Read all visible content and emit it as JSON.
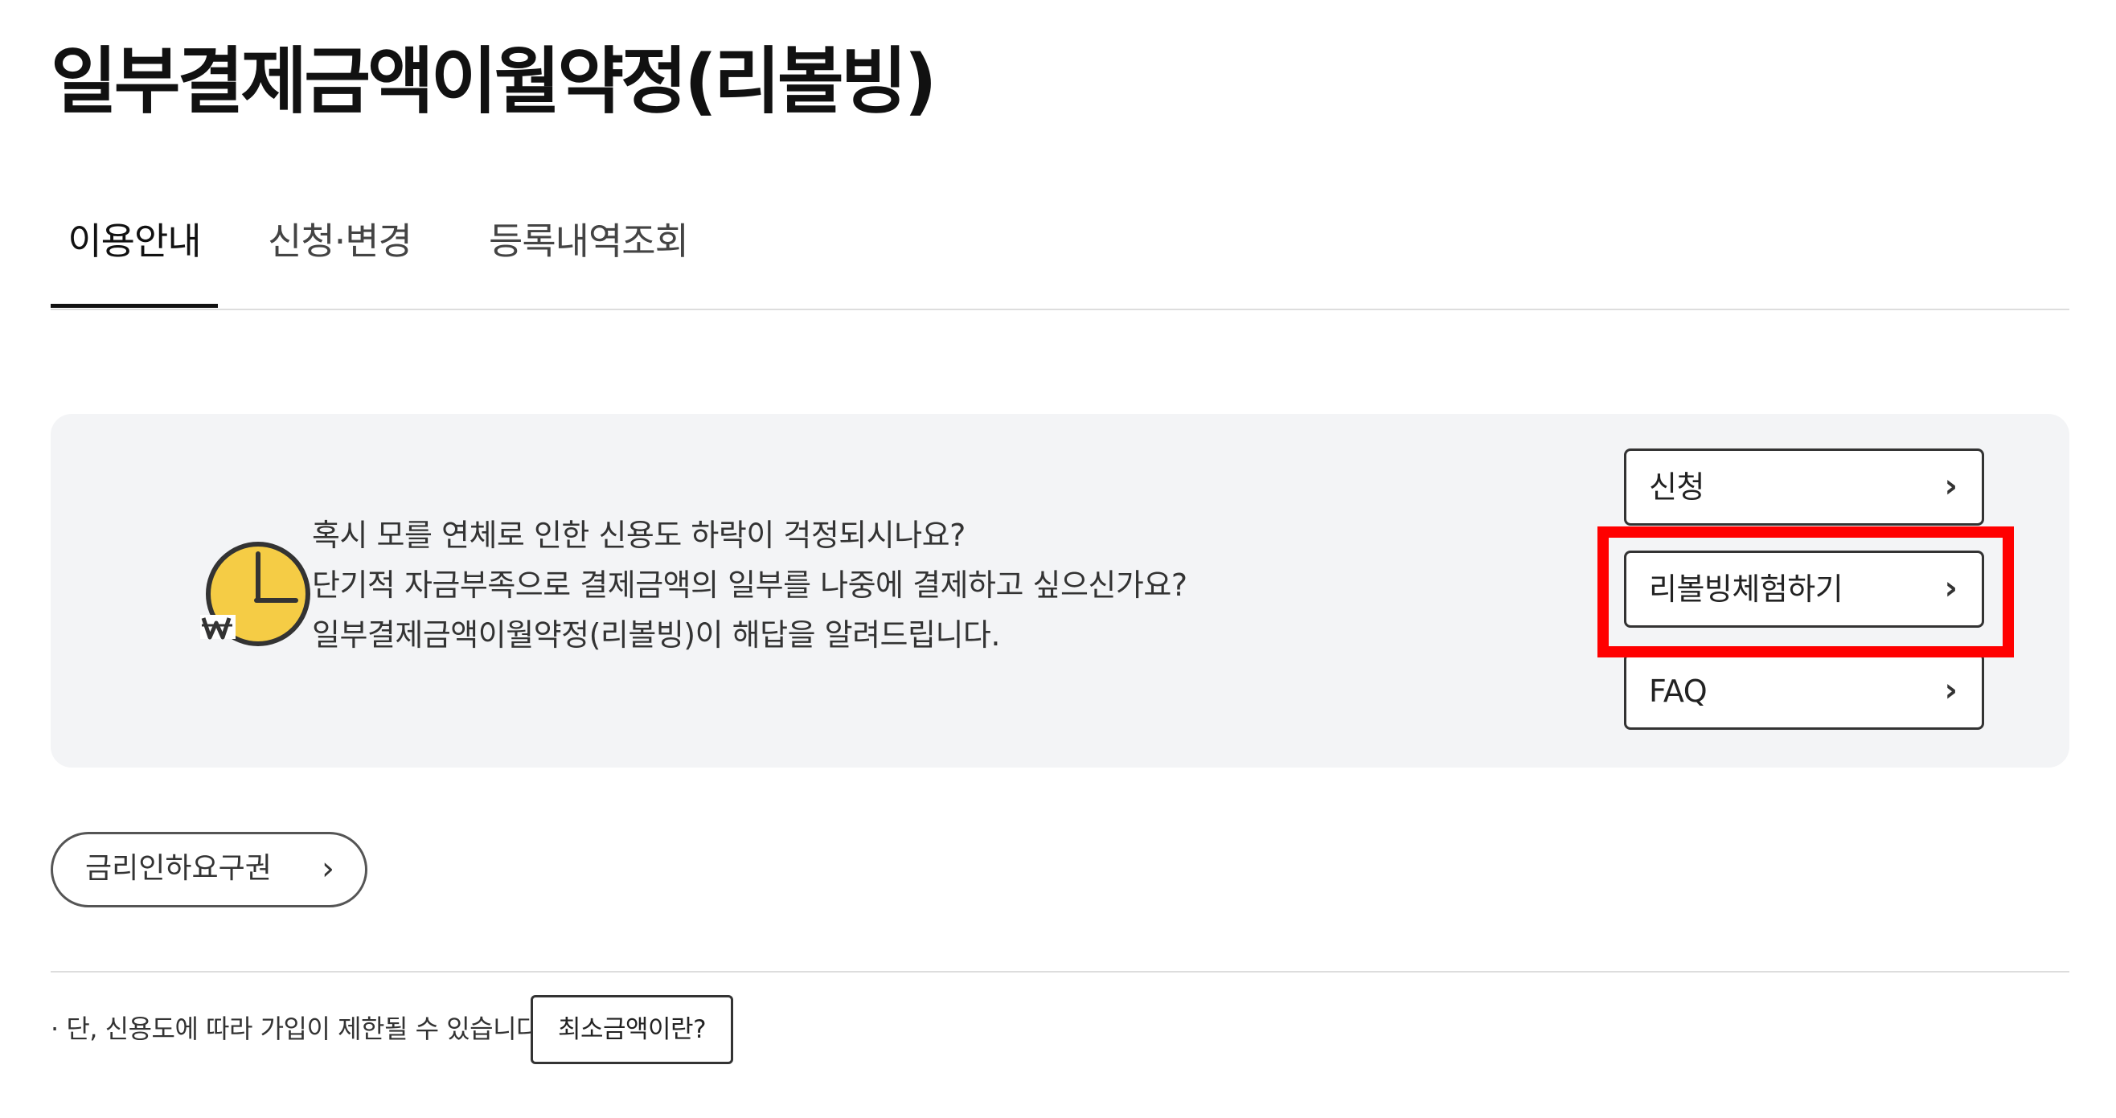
{
  "page": {
    "title": "일부결제금액이월약정(리볼빙)"
  },
  "tabs": [
    {
      "label": "이용안내",
      "active": true
    },
    {
      "label": "신청·변경",
      "active": false
    },
    {
      "label": "등록내역조회",
      "active": false
    }
  ],
  "info": {
    "icon": "clock-won-icon",
    "lines": [
      "혹시 모를 연체로 인한 신용도 하락이 걱정되시나요?",
      "단기적 자금부족으로 결제금액의 일부를 나중에 결제하고 싶으신가요?",
      "일부결제금액이월약정(리볼빙)이 해답을 알려드립니다."
    ],
    "buttons": {
      "apply": "신청",
      "trial": "리볼빙체험하기",
      "faq": "FAQ"
    },
    "chevron": "›"
  },
  "rate_cut": {
    "label": "금리인하요구권",
    "chevron": "›"
  },
  "footer": {
    "note": "· 단, 신용도에 따라 가입이 제한될 수 있습니다.",
    "min_amount_button": "최소금액이란?"
  },
  "colors": {
    "highlight": "#ff0000",
    "info_background": "#f3f4f6",
    "clock_fill": "#f5cc45"
  }
}
